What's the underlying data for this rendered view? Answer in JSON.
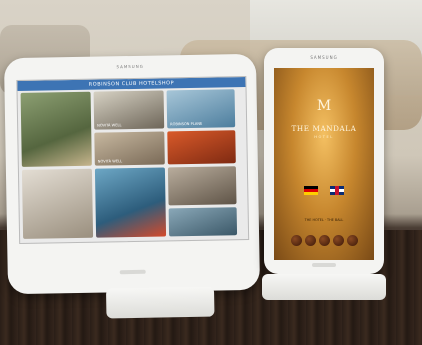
{
  "tablet": {
    "brand": "SAMSUNG",
    "header": "ROBINSON CLUB HOTELSHOP",
    "tiles": [
      {
        "label": ""
      },
      {
        "label": "NOVITÀ WELL"
      },
      {
        "label": "ROBINSON PLANE"
      },
      {
        "label": "NOVITÀ WELL"
      },
      {
        "label": ""
      },
      {
        "label": ""
      },
      {
        "label": ""
      },
      {
        "label": ""
      },
      {
        "label": ""
      }
    ]
  },
  "phone": {
    "brand": "SAMSUNG",
    "logo": "M",
    "name": "THE MANDALA",
    "subtitle": "HOTEL",
    "tiny_text": "THE HOTEL · THE BALL"
  },
  "colors": {
    "tablet_header": "#3d74b4",
    "phone_screen": "#c7872e",
    "table_wood": "#2a1e17"
  }
}
